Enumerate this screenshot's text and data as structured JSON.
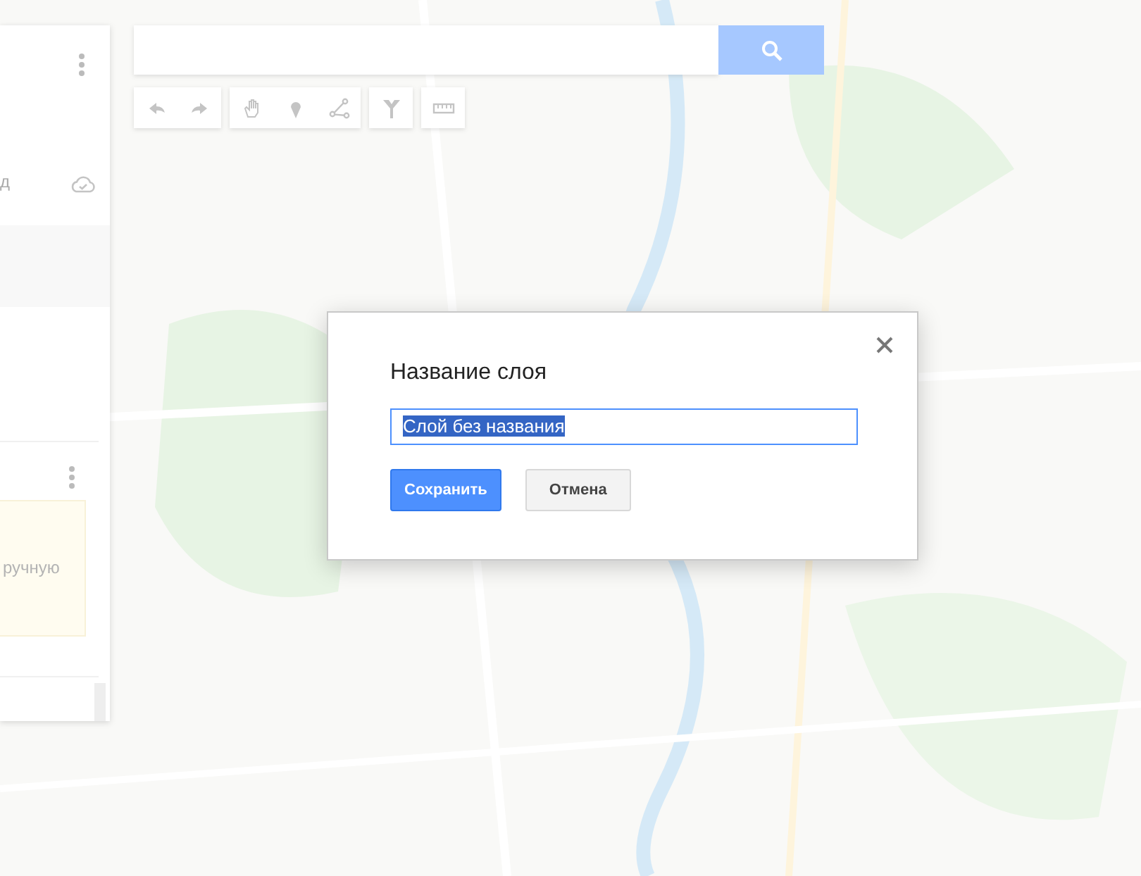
{
  "side_panel": {
    "layer_label": "д",
    "note_text": "ручную"
  },
  "dialog": {
    "title": "Название слоя",
    "field": {
      "value": "Слой без названия",
      "selected": true
    },
    "buttons": [
      {
        "label": "Сохранить",
        "kind": "primary"
      },
      {
        "label": "Отмена",
        "kind": "secondary"
      }
    ]
  }
}
